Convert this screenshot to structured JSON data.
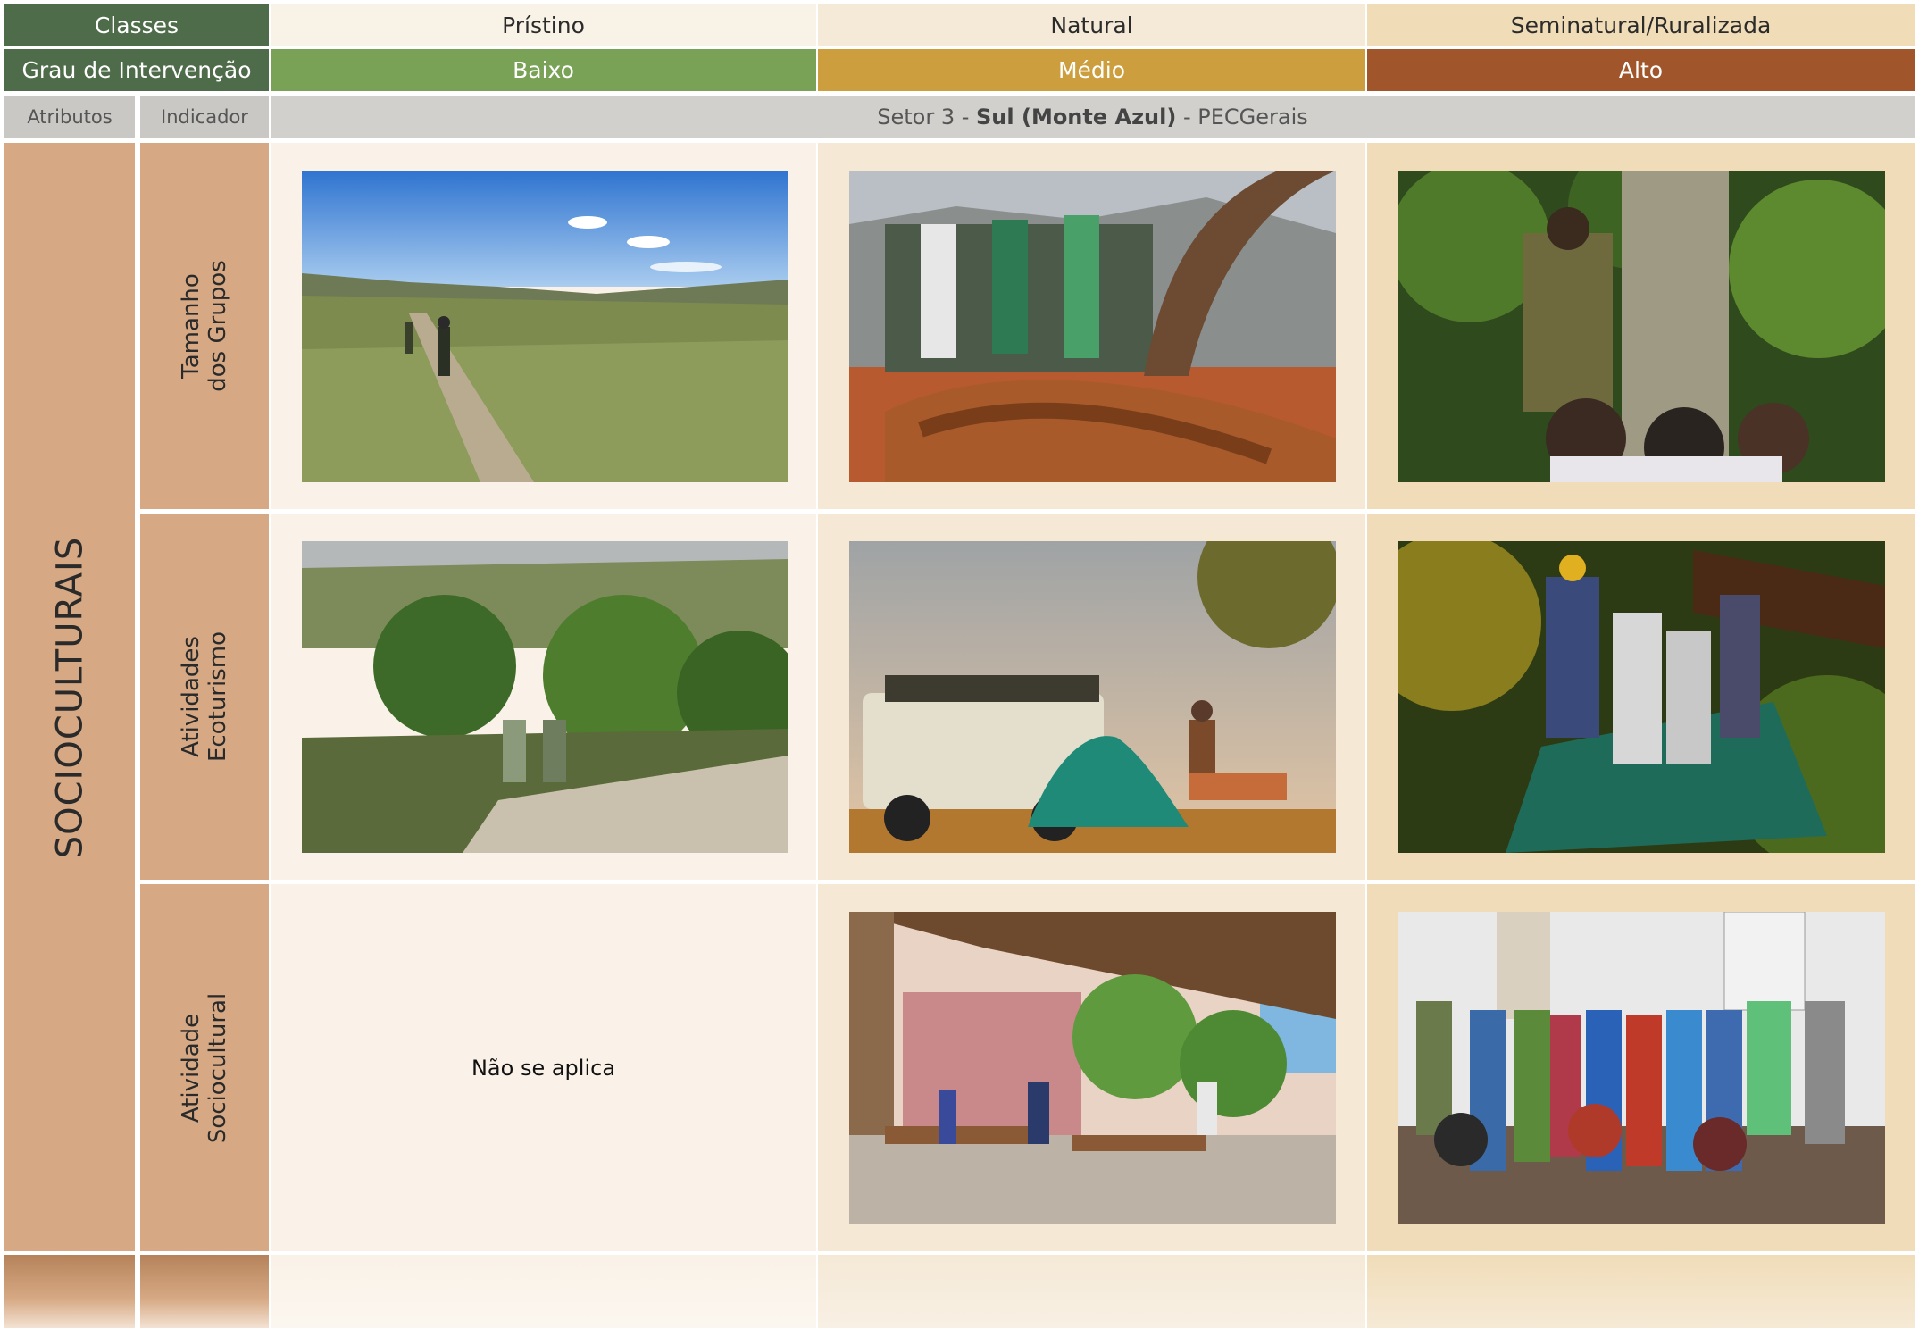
{
  "header": {
    "classes_label": "Classes",
    "classes": [
      "Prístino",
      "Natural",
      "Seminatural/Ruralizada"
    ],
    "grau_label": "Grau de Intervenção",
    "graus": [
      "Baixo",
      "Médio",
      "Alto"
    ],
    "atributos_label": "Atributos",
    "indicador_label": "Indicador",
    "sector": {
      "prefix": "Setor 3 - ",
      "bold": "Sul (Monte Azul)",
      "suffix": " - PECGerais"
    }
  },
  "attribute": "SOCIOCULTURAIS",
  "rows": [
    {
      "indicator": "Tamanho\ndos Grupos",
      "cells": [
        "photo-trail-hikers",
        "photo-group-at-sign",
        "photo-tree-education"
      ]
    },
    {
      "indicator": "Atividades\nEcoturismo",
      "cells": [
        "photo-canyon-hikers",
        "photo-jeep-camping",
        "photo-treetop-adventure"
      ]
    },
    {
      "indicator": "Atividade\nSociocultural",
      "cells": [
        "Não se aplica",
        "photo-outdoor-restaurant",
        "photo-folk-group"
      ]
    }
  ],
  "colors": {
    "dark_green": "#4e6c49",
    "low": "#79a257",
    "medium": "#cc9e3d",
    "high": "#a1552b",
    "tan": "#d6a984"
  }
}
